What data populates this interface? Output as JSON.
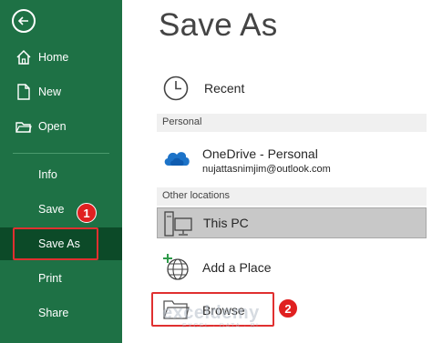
{
  "sidebar": {
    "back_icon": "back-arrow-icon",
    "items": [
      {
        "label": "Home",
        "icon": "home-icon"
      },
      {
        "label": "New",
        "icon": "new-document-icon"
      },
      {
        "label": "Open",
        "icon": "open-folder-icon"
      },
      {
        "label": "Info"
      },
      {
        "label": "Save"
      },
      {
        "label": "Save As",
        "selected": true
      },
      {
        "label": "Print"
      },
      {
        "label": "Share"
      }
    ]
  },
  "main": {
    "title": "Save As",
    "recent": {
      "label": "Recent",
      "icon": "clock-icon"
    },
    "sections": {
      "personal": "Personal",
      "other": "Other locations"
    },
    "onedrive": {
      "label": "OneDrive - Personal",
      "email": "nujattasnimjim@outlook.com",
      "icon": "cloud-icon"
    },
    "this_pc": {
      "label": "This PC",
      "icon": "computer-icon"
    },
    "add_place": {
      "label": "Add a Place",
      "icon": "globe-plus-icon"
    },
    "browse": {
      "label": "Browse",
      "icon": "folder-icon"
    }
  },
  "annotations": {
    "step1": "1",
    "step2": "2",
    "marker_color": "#e03030"
  },
  "watermark": {
    "brand": "exceldemy",
    "tagline": "EXCEL · DATA · BI"
  },
  "colors": {
    "sidebar": "#1e7145",
    "selected": "#0c4a28",
    "accent": "#e03030"
  }
}
